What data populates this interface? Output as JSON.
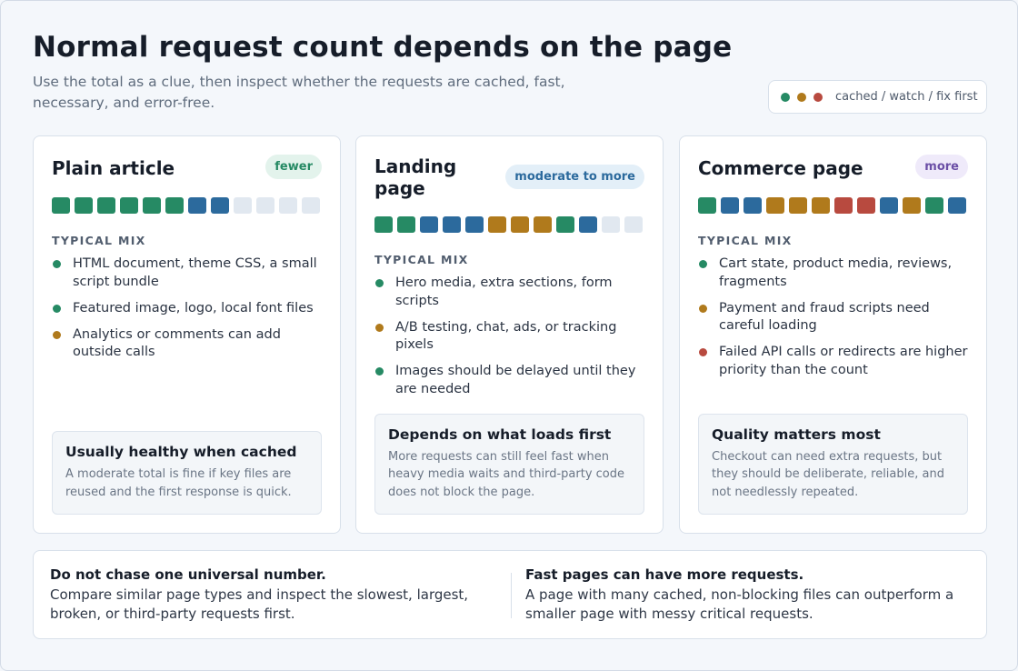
{
  "header": {
    "title": "Normal request count depends on the page",
    "subtitle": "Use the total as a clue, then inspect whether the requests are cached, fast, necessary, and error-free."
  },
  "legend": {
    "text": "cached / watch / fix first",
    "dots": [
      "green",
      "amber",
      "red"
    ]
  },
  "colors": {
    "green": "#268a64",
    "blue": "#2c6a9d",
    "amber": "#b07a1c",
    "red": "#b84a3f",
    "empty": "#e1e8f0"
  },
  "section_label": "TYPICAL MIX",
  "cards": [
    {
      "title": "Plain article",
      "badge": "fewer",
      "badge_bg": "#e3f3ec",
      "badge_fg": "#268a64",
      "blocks": [
        "green",
        "green",
        "green",
        "green",
        "green",
        "green",
        "blue",
        "blue",
        "empty",
        "empty",
        "empty",
        "empty"
      ],
      "items": [
        {
          "text": "HTML document, theme CSS, a small script bundle",
          "dot": "green"
        },
        {
          "text": "Featured image, logo, local font files",
          "dot": "green"
        },
        {
          "text": "Analytics or comments can add outside calls",
          "dot": "amber"
        }
      ],
      "note_title": "Usually healthy when cached",
      "note_body": "A moderate total is fine if key files are reused and the first response is quick."
    },
    {
      "title": "Landing page",
      "badge": "moderate to more",
      "badge_bg": "#e3eff8",
      "badge_fg": "#2c6a9d",
      "blocks": [
        "green",
        "green",
        "blue",
        "blue",
        "blue",
        "amber",
        "amber",
        "amber",
        "green",
        "blue",
        "empty",
        "empty"
      ],
      "items": [
        {
          "text": "Hero media, extra sections, form scripts",
          "dot": "green"
        },
        {
          "text": "A/B testing, chat, ads, or tracking pixels",
          "dot": "amber"
        },
        {
          "text": "Images should be delayed until they are needed",
          "dot": "green"
        }
      ],
      "note_title": "Depends on what loads first",
      "note_body": "More requests can still feel fast when heavy media waits and third-party code does not block the page."
    },
    {
      "title": "Commerce page",
      "badge": "more",
      "badge_bg": "#efeafa",
      "badge_fg": "#6b4fa6",
      "blocks": [
        "green",
        "blue",
        "blue",
        "amber",
        "amber",
        "amber",
        "red",
        "red",
        "blue",
        "amber",
        "green",
        "blue"
      ],
      "items": [
        {
          "text": "Cart state, product media, reviews, fragments",
          "dot": "green"
        },
        {
          "text": "Payment and fraud scripts need careful loading",
          "dot": "amber"
        },
        {
          "text": "Failed API calls or redirects are higher priority than the count",
          "dot": "red"
        }
      ],
      "note_title": "Quality matters most",
      "note_body": "Checkout can need extra requests, but they should be deliberate, reliable, and not needlessly repeated."
    }
  ],
  "footer": {
    "left_head": "Do not chase one universal number.",
    "left_body": "Compare similar page types and inspect the slowest, largest, broken, or third-party requests first.",
    "right_head": "Fast pages can have more requests.",
    "right_body": "A page with many cached, non-blocking files can outperform a smaller page with messy critical requests."
  }
}
